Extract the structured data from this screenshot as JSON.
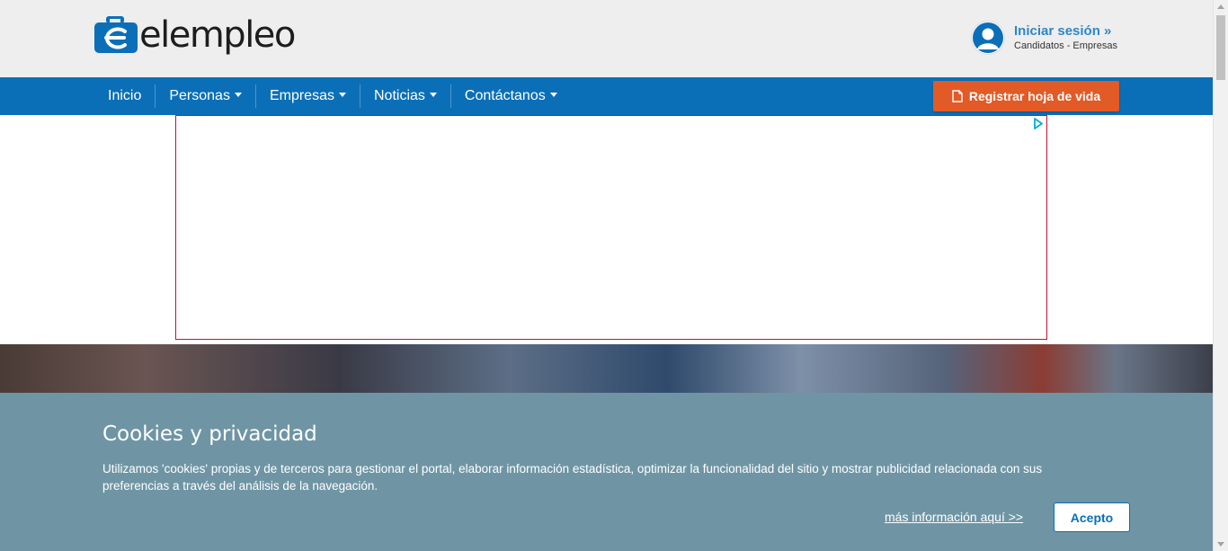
{
  "brand": {
    "logo_text": "elempleo",
    "primary_color": "#0b6fb8",
    "accent_color": "#e25a26"
  },
  "login": {
    "link_label": "Iniciar sesión",
    "link_icon": "double-chevron-right-icon",
    "subtitle": "Candidatos - Empresas",
    "avatar_icon": "user-avatar-icon"
  },
  "nav": {
    "items": [
      {
        "label": "Inicio",
        "dropdown": false
      },
      {
        "label": "Personas",
        "dropdown": true
      },
      {
        "label": "Empresas",
        "dropdown": true
      },
      {
        "label": "Noticias",
        "dropdown": true
      },
      {
        "label": "Contáctanos",
        "dropdown": true
      }
    ],
    "cta_label": "Registrar hoja de vida",
    "cta_icon": "document-icon"
  },
  "ad": {
    "choices_icon": "adchoices-icon"
  },
  "cookie": {
    "title": "Cookies y privacidad",
    "text": "Utilizamos 'cookies' propias y de terceros para gestionar el portal, elaborar información estadística, optimizar la funcionalidad del sitio y mostrar publicidad relacionada con sus preferencias a través del análisis de la navegación.",
    "more_label": "más información aquí >>",
    "accept_label": "Acepto",
    "background_color": "#6f95a5"
  }
}
